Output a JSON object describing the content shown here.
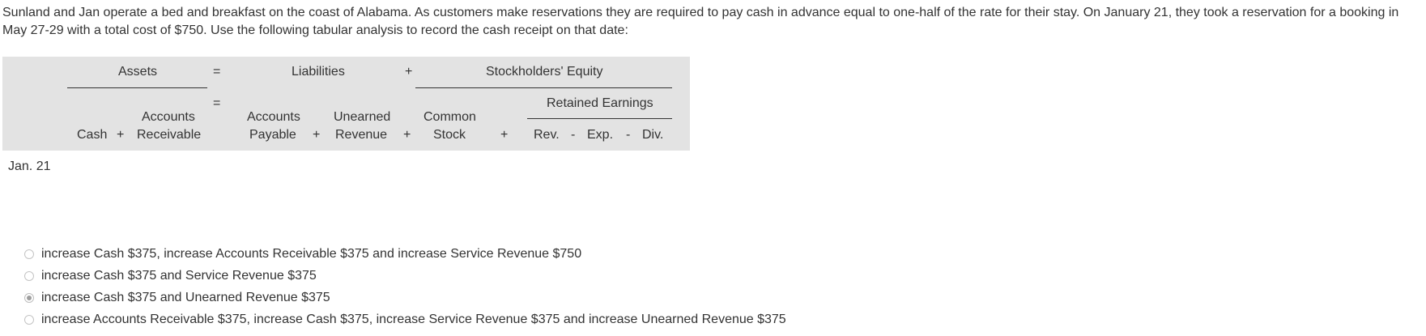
{
  "question": {
    "text": "Sunland and Jan operate a bed and breakfast on the coast of Alabama. As customers make reservations they are required to pay cash in advance equal to one-half of the rate for their stay. On January 21, they took a reservation for a booking in May 27-29 with a total cost of $750. Use the following tabular analysis to record the cash receipt on that date:"
  },
  "table": {
    "assets": "Assets",
    "eq1": "=",
    "liabilities": "Liabilities",
    "plus_top": "+",
    "equity": "Stockholders' Equity",
    "eq2": "=",
    "retained": "Retained Earnings",
    "accounts_receivable_l1": "Accounts",
    "accounts_receivable_l2": "Receivable",
    "cash": "Cash",
    "plus1": "+",
    "accounts_payable_l1": "Accounts",
    "accounts_payable_l2": "Payable",
    "plus2": "+",
    "unearned_l1": "Unearned",
    "unearned_l2": "Revenue",
    "plus3": "+",
    "common_l1": "Common",
    "common_l2": "Stock",
    "plus4": "+",
    "rev": "Rev.",
    "minus1": "-",
    "exp": "Exp.",
    "minus2": "-",
    "div": "Div.",
    "row_label": "Jan. 21"
  },
  "options": [
    {
      "label": "increase Cash $375, increase Accounts Receivable $375 and increase Service Revenue $750",
      "selected": false
    },
    {
      "label": "increase Cash $375 and Service Revenue $375",
      "selected": false
    },
    {
      "label": "increase Cash $375 and Unearned Revenue $375",
      "selected": true
    },
    {
      "label": "increase Accounts Receivable $375, increase Cash $375, increase Service Revenue $375 and increase Unearned Revenue $375",
      "selected": false
    }
  ]
}
